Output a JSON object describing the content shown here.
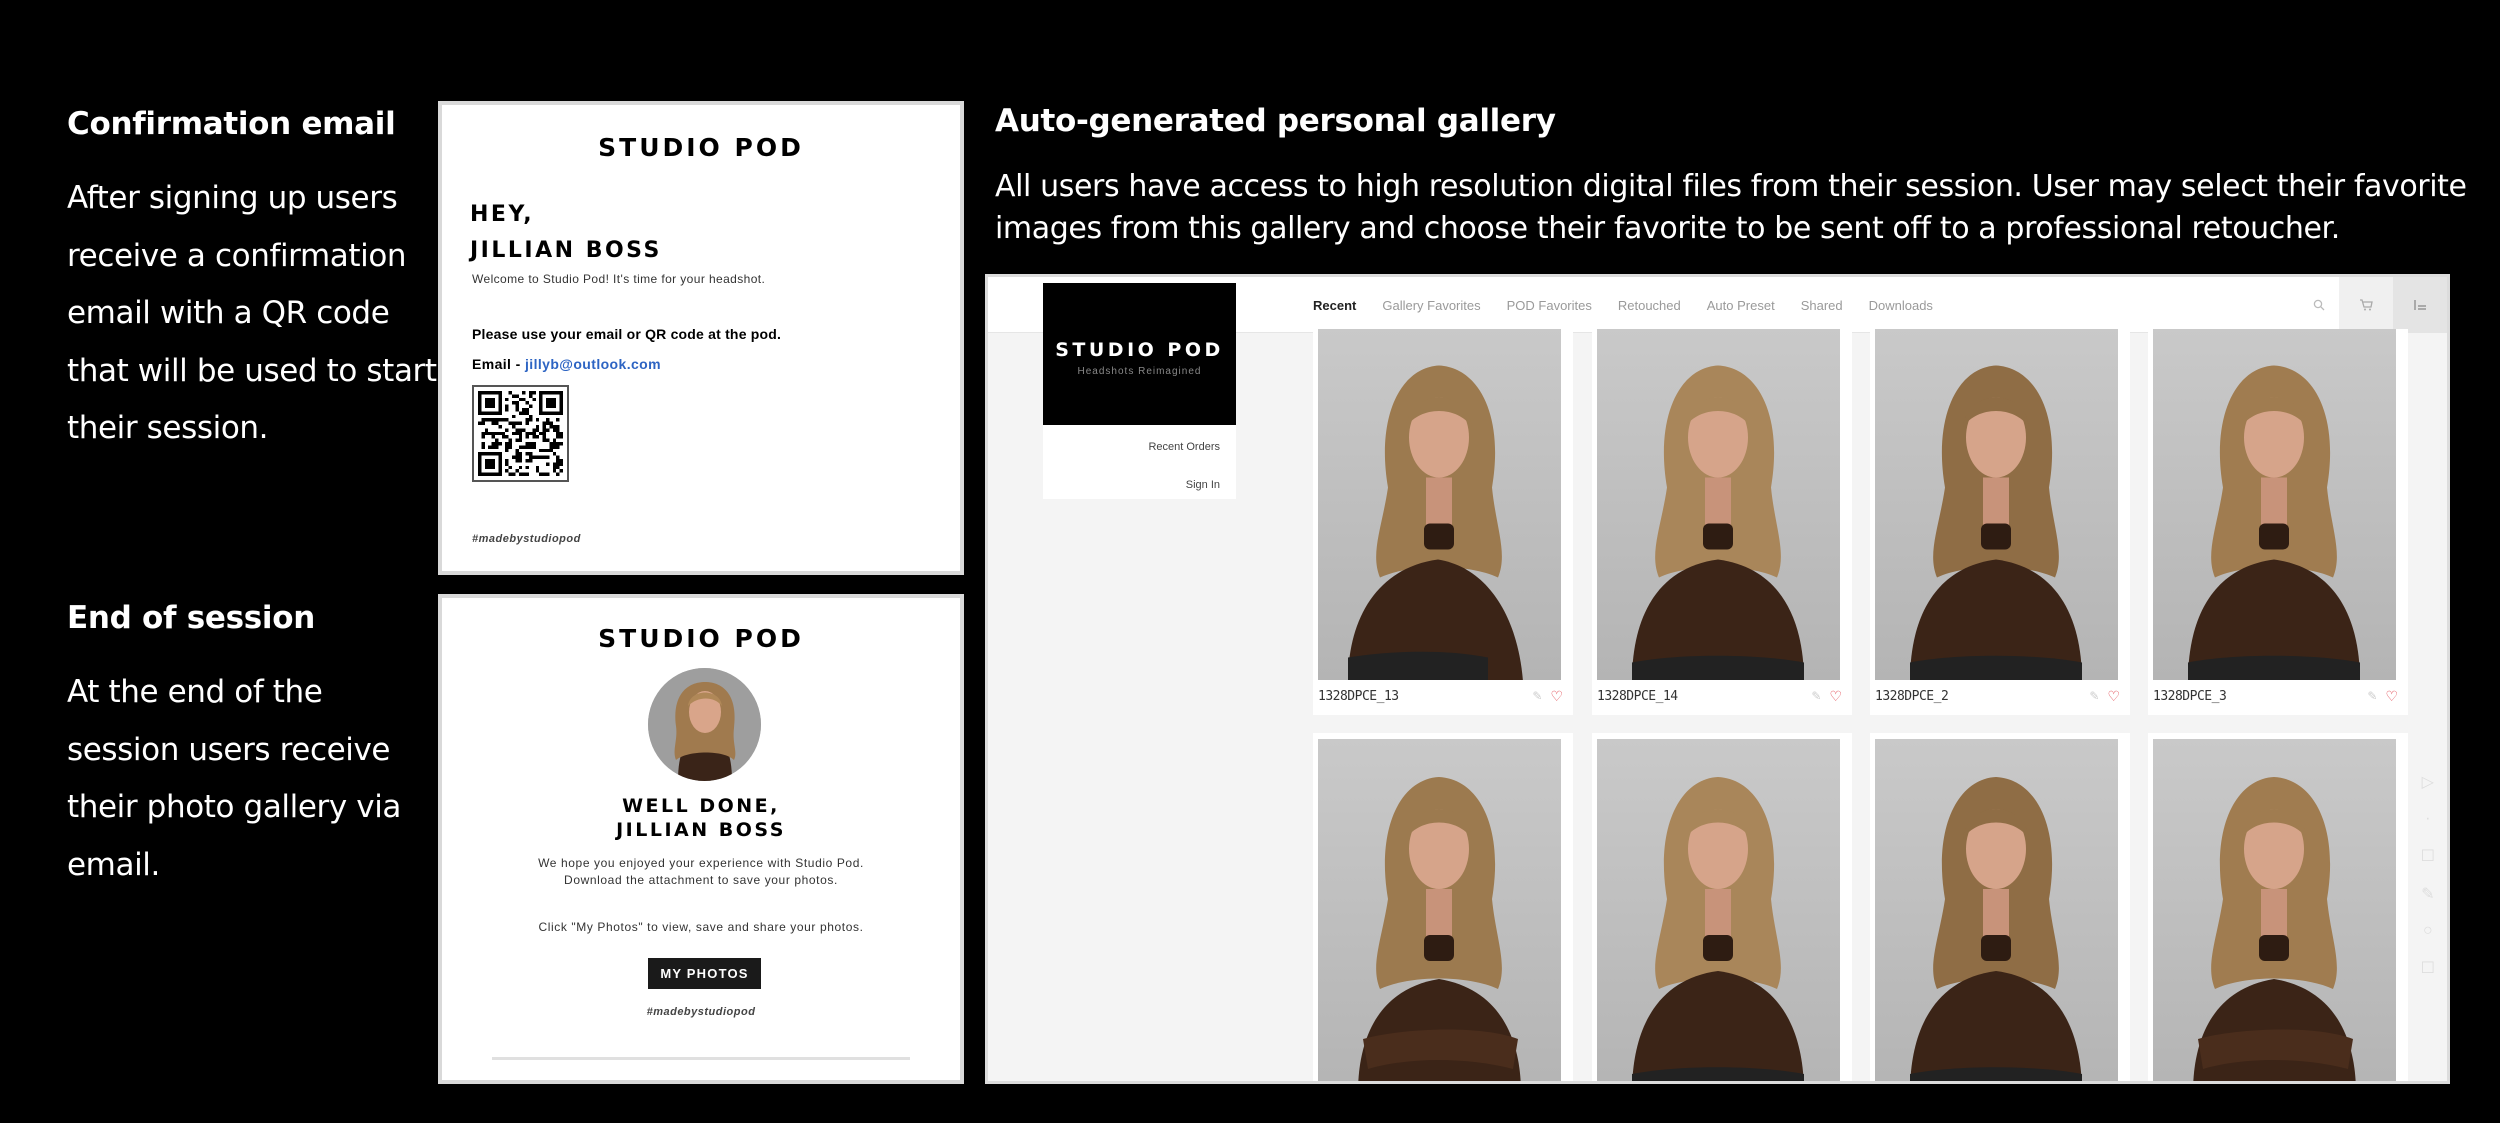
{
  "confirm_caption": {
    "title": "Confirmation email",
    "body": "After signing up users receive a confirmation email with a QR code that will be used to start their session."
  },
  "end_caption": {
    "title": "End of session",
    "body": "At the end of the session users receive their photo gallery via email."
  },
  "confirm_email": {
    "brand": "STUDIO POD",
    "greeting_line1": "HEY,",
    "greeting_line2": "JILLIAN BOSS",
    "welcome": "Welcome to Studio Pod! It's time for your headshot.",
    "instruction": "Please use your email or QR code at the pod.",
    "email_label": "Email - ",
    "email_value": "jillyb@outlook.com",
    "hashtag": "#madebystudiopod",
    "link_color": "#2d64c3"
  },
  "end_email": {
    "brand": "STUDIO POD",
    "done_line1": "WELL DONE,",
    "done_line2": "JILLIAN BOSS",
    "hope_line1": "We hope you enjoyed your experience with Studio Pod.",
    "hope_line2": "Download the attachment to save your photos.",
    "click_text": "Click \"My Photos\" to view, save and share your photos.",
    "button_label": "MY PHOTOS",
    "hashtag": "#madebystudiopod"
  },
  "gallery": {
    "title": "Auto-generated personal gallery",
    "description": "All users have access to high resolution digital files from their session. User may select their favorite images from this gallery and choose their favorite to be sent off to a professional retoucher."
  },
  "app": {
    "logo_name": "STUDIO POD",
    "logo_tagline": "Headshots Reimagined",
    "menu": [
      "Recent Orders",
      "Sign In"
    ],
    "tabs": [
      "Recent",
      "Gallery Favorites",
      "POD Favorites",
      "Retouched",
      "Auto Preset",
      "Shared",
      "Downloads"
    ],
    "active_tab": "Recent",
    "icons": [
      "search-icon",
      "cart-icon",
      "list-icon"
    ],
    "photos_row1": [
      "1328DPCE_13",
      "1328DPCE_14",
      "1328DPCE_2",
      "1328DPCE_3"
    ],
    "photos_row2_count_visible": 4,
    "heart_color": "#e0404a"
  }
}
